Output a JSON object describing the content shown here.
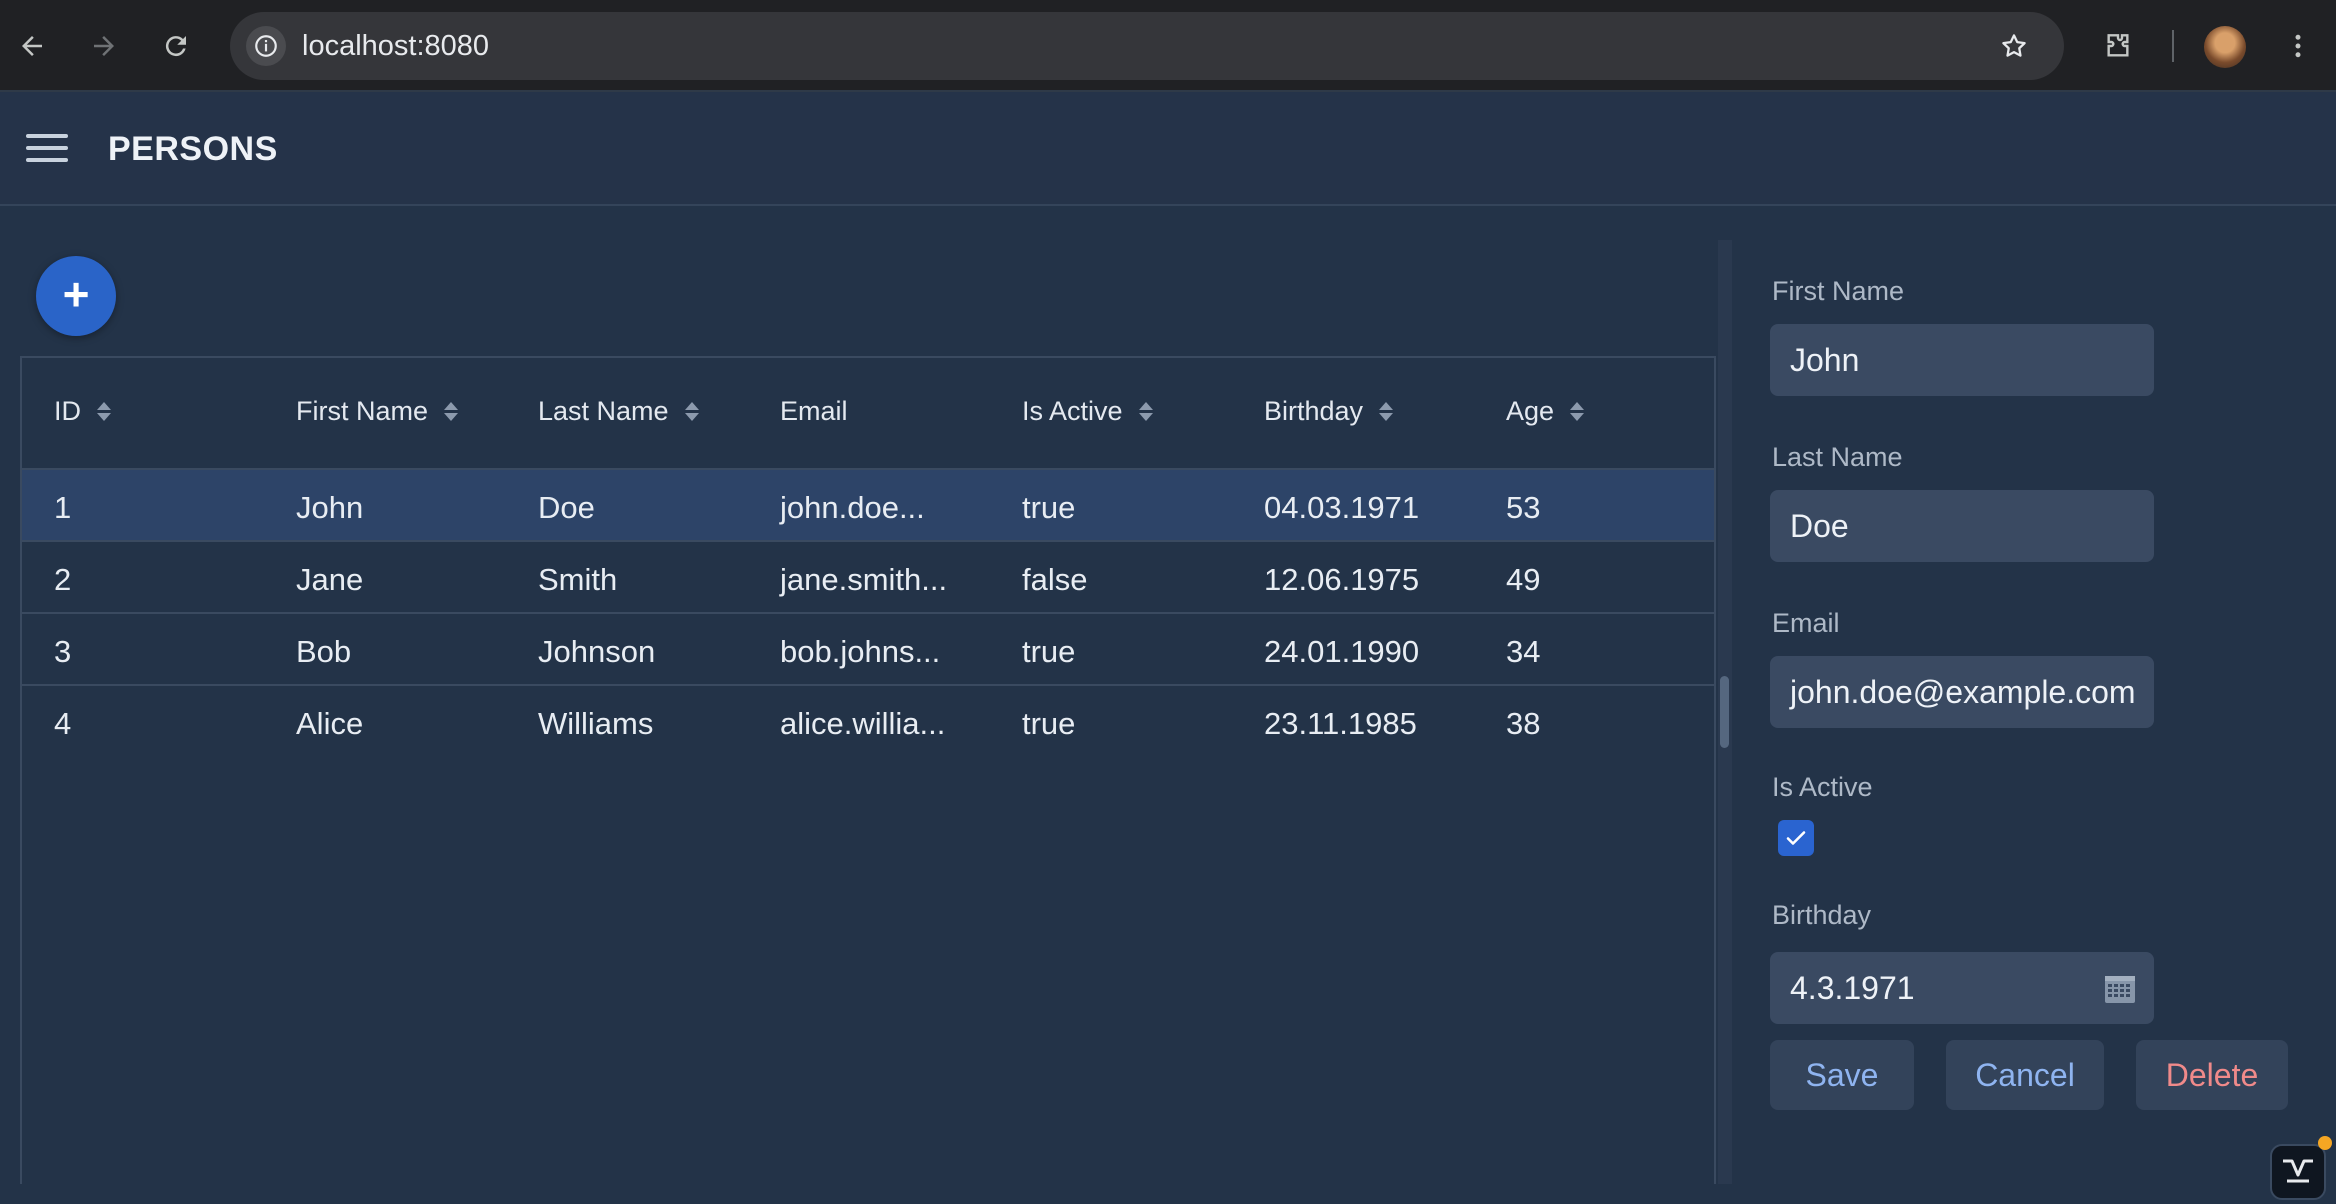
{
  "browser": {
    "url": "localhost:8080",
    "icons": [
      "back-arrow-icon",
      "forward-arrow-icon",
      "reload-icon",
      "site-info-icon",
      "bookmark-star-icon",
      "extensions-puzzle-icon",
      "profile-avatar",
      "kebab-menu-icon"
    ]
  },
  "appbar": {
    "title": "PERSONS"
  },
  "grid": {
    "columns": [
      "ID",
      "First Name",
      "Last Name",
      "Email",
      "Is Active",
      "Birthday",
      "Age"
    ],
    "sortable": [
      true,
      true,
      true,
      false,
      true,
      true,
      true
    ],
    "rows": [
      [
        "1",
        "John",
        "Doe",
        "john.doe...",
        "true",
        "04.03.1971",
        "53"
      ],
      [
        "2",
        "Jane",
        "Smith",
        "jane.smith...",
        "false",
        "12.06.1975",
        "49"
      ],
      [
        "3",
        "Bob",
        "Johnson",
        "bob.johns...",
        "true",
        "24.01.1990",
        "34"
      ],
      [
        "4",
        "Alice",
        "Williams",
        "alice.willia...",
        "true",
        "23.11.1985",
        "38"
      ]
    ],
    "selected_row": 0
  },
  "editor": {
    "first_name": {
      "label": "First Name",
      "value": "John"
    },
    "last_name": {
      "label": "Last Name",
      "value": "Doe"
    },
    "email": {
      "label": "Email",
      "value": "john.doe@example.com"
    },
    "is_active": {
      "label": "Is Active",
      "checked": true
    },
    "birthday": {
      "label": "Birthday",
      "value": "4.3.1971"
    },
    "buttons": {
      "save": "Save",
      "cancel": "Cancel",
      "delete": "Delete"
    }
  },
  "colors": {
    "accent": "#2a64c8",
    "save_text": "#8fb4f0",
    "cancel_text": "#8fb4f0",
    "delete_text": "#f08a8a"
  }
}
